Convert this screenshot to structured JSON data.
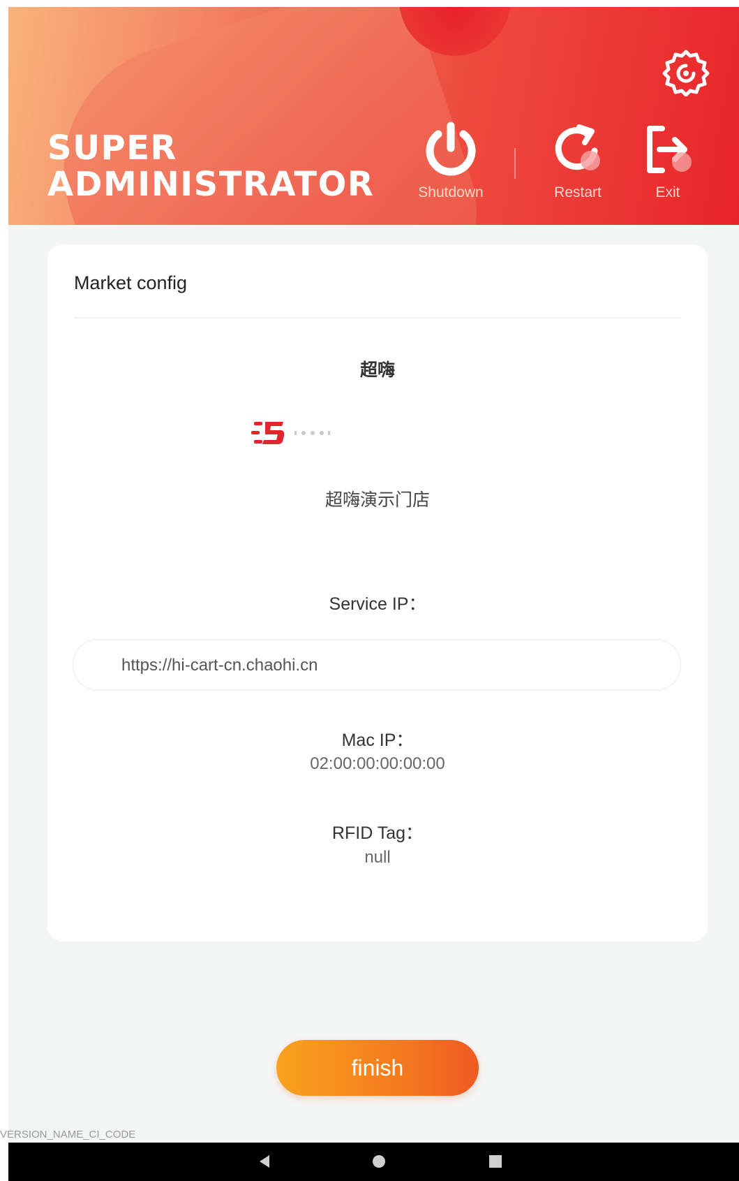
{
  "header": {
    "title_line1": "SUPER",
    "title_line2": "ADMINISTRATOR",
    "shutdown_label": "Shutdown",
    "restart_label": "Restart",
    "exit_label": "Exit",
    "settings_icon": "gear-icon",
    "gradient_colors": [
      "#f9b37c",
      "#ee4a3e",
      "#e8242a"
    ]
  },
  "card": {
    "title": "Market config",
    "store_short_name": "超嗨",
    "store_name": "超嗨演示门店",
    "service_ip_label": "Service IP：",
    "service_ip_value": "https://hi-cart-cn.chaohi.cn",
    "mac_label": "Mac IP：",
    "mac_value": "02:00:00:00:00:00",
    "rfid_label": "RFID Tag：",
    "rfid_value": "null"
  },
  "footer": {
    "finish_label": "finish",
    "version_text": "VERSION_NAME_CI_CODE",
    "accent_color": "#f47b1e"
  },
  "navbar": {
    "back_icon": "back-triangle-icon",
    "home_icon": "home-circle-icon",
    "recents_icon": "recents-square-icon"
  }
}
